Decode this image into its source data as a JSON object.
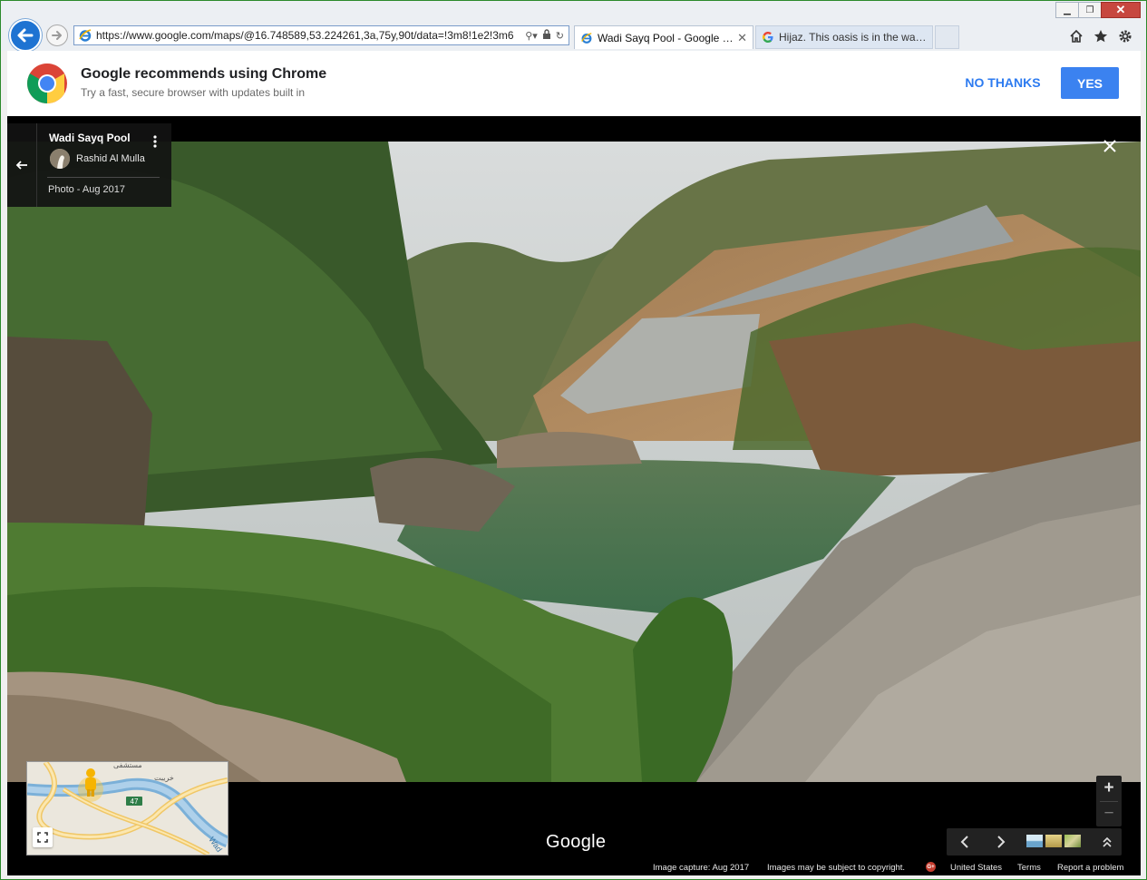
{
  "browser": {
    "url": "https://www.google.com/maps/@16.748589,53.224261,3a,75y,90t/data=!3m8!1e2!3m6",
    "tabs": [
      {
        "label": "Wadi Sayq Pool - Google M...",
        "icon": "ie-icon",
        "active": true
      },
      {
        "label": "Hijaz. This oasis is in the wadi ...",
        "icon": "google-g-icon",
        "active": false
      }
    ],
    "window_controls": [
      "minimize",
      "maximize",
      "close"
    ],
    "accent": "#1e73d2"
  },
  "banner": {
    "title": "Google recommends using Chrome",
    "subtitle": "Try a fast, secure browser with updates built in",
    "no_thanks": "NO THANKS",
    "yes": "YES",
    "accent": "#3b82f0"
  },
  "viewer": {
    "place_title": "Wadi Sayq Pool",
    "author": "Rashid Al Mulla",
    "photo_date": "Photo - Aug 2017",
    "minimap": {
      "route_number": "47",
      "labels": [
        "مستشفى",
        "خريبت",
        "Wad"
      ]
    },
    "zoom_in": "+",
    "zoom_out": "−",
    "brand": "Google"
  },
  "footer": {
    "capture": "Image capture: Aug 2017",
    "copyright": "Images may be subject to copyright.",
    "gplus": "G+",
    "country": "United States",
    "terms": "Terms",
    "report": "Report a problem"
  }
}
